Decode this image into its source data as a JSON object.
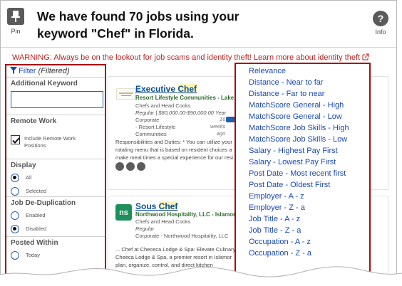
{
  "header": {
    "pin_label": "Pin",
    "title": "We have found 70 jobs using your keyword \"Chef\" in Florida.",
    "info_label": "Info"
  },
  "warning": {
    "text": "WARNING: Always be on the lookout for job scams and identity theft! ",
    "link": "Learn more about identity theft"
  },
  "filter": {
    "label": "Filter",
    "status": "(Filtered)",
    "sections": {
      "keyword": {
        "title": "Additional Keyword",
        "value": "",
        "placeholder": ""
      },
      "remote": {
        "title": "Remote Work",
        "checkbox_label_1": "Include Remote Work",
        "checkbox_label_2": "Positions",
        "checked": true
      },
      "display": {
        "title": "Display",
        "options": [
          "All",
          "Selected"
        ],
        "selected": "All"
      },
      "dedup": {
        "title": "Job De-Duplication",
        "options": [
          "Enabled",
          "Disabled"
        ],
        "selected": "Disabled"
      },
      "posted": {
        "title": "Posted Within",
        "options": [
          "Today"
        ]
      }
    }
  },
  "jobs": [
    {
      "title_pre": "Executive ",
      "title_hl": "Chef",
      "company": "Resort Lifestyle Communities - Lake W",
      "category": "Chefs and Head Cooks",
      "salary": "Regular | $80,000.00-$90,000.00 Year",
      "employer_lines": [
        "Corporate",
        "- Resort Lifestyle",
        "Communities"
      ],
      "posted_lines": [
        "16",
        "weeks",
        "ago"
      ],
      "description_lines": [
        "Responsibilities and Duties: * You can utilize your",
        "rotating menu that is based on resident choices a",
        "make meal times a special experience for our resi"
      ]
    },
    {
      "logo_text": "ns",
      "title_pre": "Sous ",
      "title_hl": "Chef",
      "company": "Northwood Hospitality, LLC - Islamor",
      "category": "Chefs and Head Cooks",
      "salary": "Regular",
      "employer": "Corporate - Northwood Hospitality, LLC",
      "description_lines": [
        "... Chef at Chececa Lodge & Spa: Elevate Culinary E",
        "Cheeca Lodge & Spa, a premier resort in Islamor",
        "plan, organize, control, and direct kitchen"
      ]
    }
  ],
  "sort_options": [
    "Relevance",
    "Distance - Near to far",
    "Distance - Far to near",
    "MatchScore General - High",
    "MatchScore General - Low",
    "MatchScore Job Skills - High",
    "MatchScore Job Skills - Low",
    "Salary - Highest Pay First",
    "Salary - Lowest Pay First",
    "Post Date - Most recent first",
    "Post Date - Oldest First",
    "Employer - A - z",
    "Employer - Z - a",
    "Job Title - A - z",
    "Job Title - Z - a",
    "Occupation - A - z",
    "Occupation - Z - a"
  ],
  "colors": {
    "accent_red": "#a60d0d",
    "warning_red": "#c0201f",
    "link_blue": "#1a47b8",
    "job_title_blue": "#0b4e9a",
    "company_green": "#2d6a2d"
  },
  "icons": [
    "pin-icon",
    "info-icon",
    "external-link-icon",
    "filter-icon",
    "check-icon"
  ]
}
